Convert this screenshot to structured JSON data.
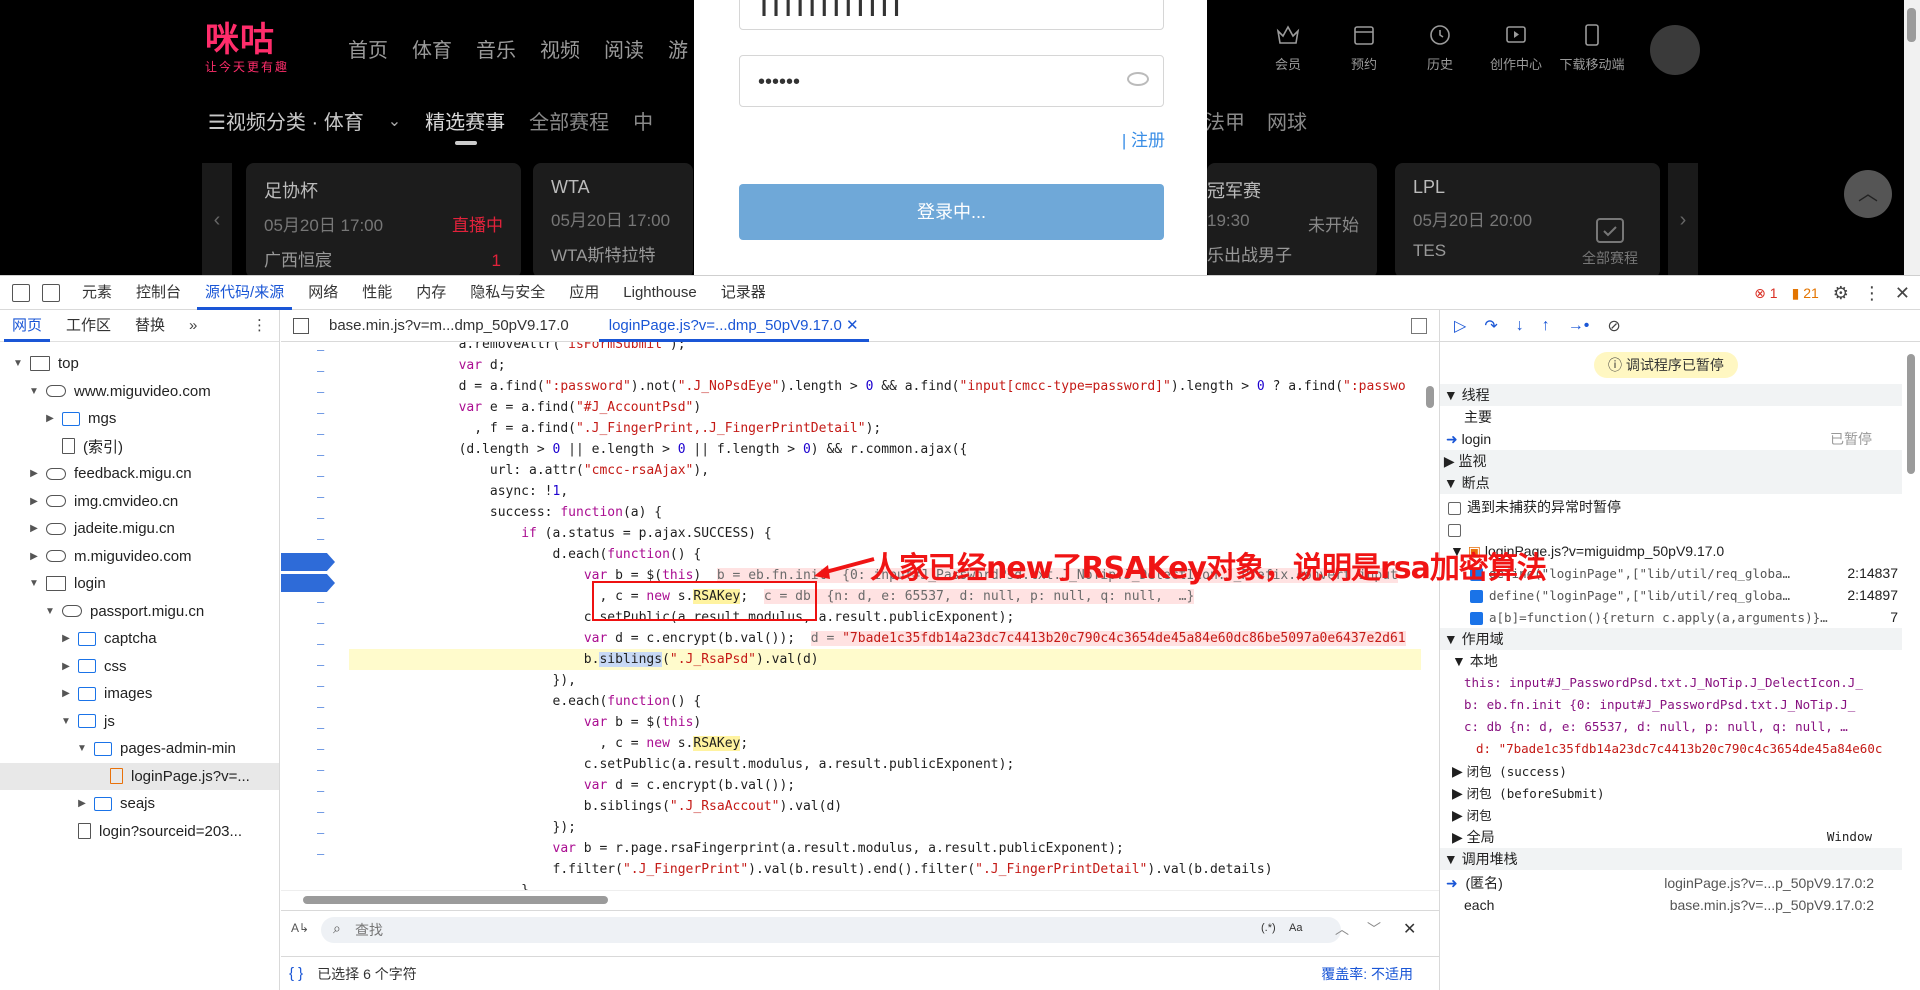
{
  "site": {
    "logo_text": "咪咕",
    "logo_slogan": "让今天更有趣",
    "nav": [
      "首页",
      "体育",
      "音乐",
      "视频",
      "阅读",
      "游"
    ],
    "user_nav": [
      "会员",
      "预约",
      "历史",
      "创作中心",
      "下载移动端"
    ],
    "category_label": "☰视频分类 · 体育",
    "tabs": [
      "精选赛事",
      "全部赛程",
      "中"
    ],
    "tabs_right": [
      "法甲",
      "网球"
    ],
    "cards": [
      {
        "name": "足协杯",
        "time": "05月20日 17:00",
        "status": "直播中",
        "status_color": "#e2223b",
        "team": "广西恒宸",
        "score": "1"
      },
      {
        "name": "WTA",
        "time": "05月20日 17:00",
        "status": "",
        "status_color": "#777",
        "team": "WTA斯特拉特",
        "score": ""
      },
      {
        "name": "冠军赛",
        "time": "19:30",
        "status": "未开始",
        "status_color": "#888",
        "team": "乐出战男子",
        "score": ""
      },
      {
        "name": "LPL",
        "time": "05月20日 20:00",
        "status": "",
        "status_color": "#888",
        "team": "TES",
        "score": ""
      }
    ],
    "all_schedule": "全部赛程"
  },
  "login": {
    "password_mask": "••••••",
    "register": "| 注册",
    "submit": "登录中..."
  },
  "devtools": {
    "main_tabs": [
      "元素",
      "控制台",
      "源代码/来源",
      "网络",
      "性能",
      "内存",
      "隐私与安全",
      "应用",
      "Lighthouse",
      "记录器"
    ],
    "active_main_tab": 2,
    "errors": "1",
    "warnings": "21",
    "nav_tabs": [
      "网页",
      "工作区",
      "替换"
    ],
    "tree": [
      {
        "label": "top",
        "indent": 0,
        "tri": "▼",
        "icon": "frame"
      },
      {
        "label": "www.miguvideo.com",
        "indent": 1,
        "tri": "▼",
        "icon": "cloud"
      },
      {
        "label": "mgs",
        "indent": 2,
        "tri": "▶",
        "icon": "folder"
      },
      {
        "label": "(索引)",
        "indent": 2,
        "tri": "",
        "icon": "file"
      },
      {
        "label": "feedback.migu.cn",
        "indent": 1,
        "tri": "▶",
        "icon": "cloud"
      },
      {
        "label": "img.cmvideo.cn",
        "indent": 1,
        "tri": "▶",
        "icon": "cloud"
      },
      {
        "label": "jadeite.migu.cn",
        "indent": 1,
        "tri": "▶",
        "icon": "cloud"
      },
      {
        "label": "m.miguvideo.com",
        "indent": 1,
        "tri": "▶",
        "icon": "cloud"
      },
      {
        "label": "login",
        "indent": 1,
        "tri": "▼",
        "icon": "frame"
      },
      {
        "label": "passport.migu.cn",
        "indent": 2,
        "tri": "▼",
        "icon": "cloud"
      },
      {
        "label": "captcha",
        "indent": 3,
        "tri": "▶",
        "icon": "folder"
      },
      {
        "label": "css",
        "indent": 3,
        "tri": "▶",
        "icon": "folder"
      },
      {
        "label": "images",
        "indent": 3,
        "tri": "▶",
        "icon": "folder"
      },
      {
        "label": "js",
        "indent": 3,
        "tri": "▼",
        "icon": "folder"
      },
      {
        "label": "pages-admin-min",
        "indent": 4,
        "tri": "▼",
        "icon": "folder"
      },
      {
        "label": "loginPage.js?v=...",
        "indent": 5,
        "tri": "",
        "icon": "jsfile",
        "selected": true
      },
      {
        "label": "seajs",
        "indent": 4,
        "tri": "▶",
        "icon": "folder"
      },
      {
        "label": "login?sourceid=203...",
        "indent": 3,
        "tri": "",
        "icon": "file"
      }
    ],
    "file_tabs": [
      "base.min.js?v=m...dmp_50pV9.17.0",
      "loginPage.js?v=...dmp_50pV9.17.0"
    ],
    "search_placeholder": "查找",
    "search_regex": "(.*)",
    "search_case": "Aa",
    "status_selected": "已选择 6 个字符",
    "status_coverage": "覆盖率: 不适用",
    "annotation": "人家已经new了RSAKey对象，说明是rsa加密算法"
  },
  "debugger": {
    "paused": "调试程序已暂停",
    "threads_title": "线程",
    "main_thread": "主要",
    "login_thread": "login",
    "login_state": "已暂停",
    "watch_title": "监视",
    "breakpoints_title": "断点",
    "pause_uncaught": "遇到未捕获的异常时暂停",
    "bp_file": "loginPage.js?v=miguidmp_50pV9.17.0",
    "bp_entries": [
      {
        "code": "define(\"loginPage\",[\"lib/util/req_globa…",
        "loc": "2:14837"
      },
      {
        "code": "define(\"loginPage\",[\"lib/util/req_globa…",
        "loc": "2:14897"
      },
      {
        "code": "a[b]=function(){return c.apply(a,arguments)}…",
        "loc": "7"
      }
    ],
    "scope_title": "作用域",
    "local_title": "本地",
    "scope_lines": [
      "this: input#J_PasswordPsd.txt.J_NoTip.J_DelectIcon.J_",
      "b: eb.fn.init  {0: input#J_PasswordPsd.txt.J_NoTip.J_",
      "c: db  {n: d, e: 65537, d: null, p: null, q: null,  …",
      "d: \"7bade1c35fdb14a23dc7c4413b20c790c4c3654de45a84e60c"
    ],
    "closures": [
      "闭包 (success)",
      "闭包 (beforeSubmit)",
      "闭包"
    ],
    "global_title": "全局",
    "global_value": "Window",
    "callstack_title": "调用堆栈",
    "stack": [
      {
        "fn": "(匿名)",
        "loc": "loginPage.js?v=...p_50pV9.17.0:2"
      },
      {
        "fn": "each",
        "loc": "base.min.js?v=...p_50pV9.17.0:2"
      }
    ]
  }
}
